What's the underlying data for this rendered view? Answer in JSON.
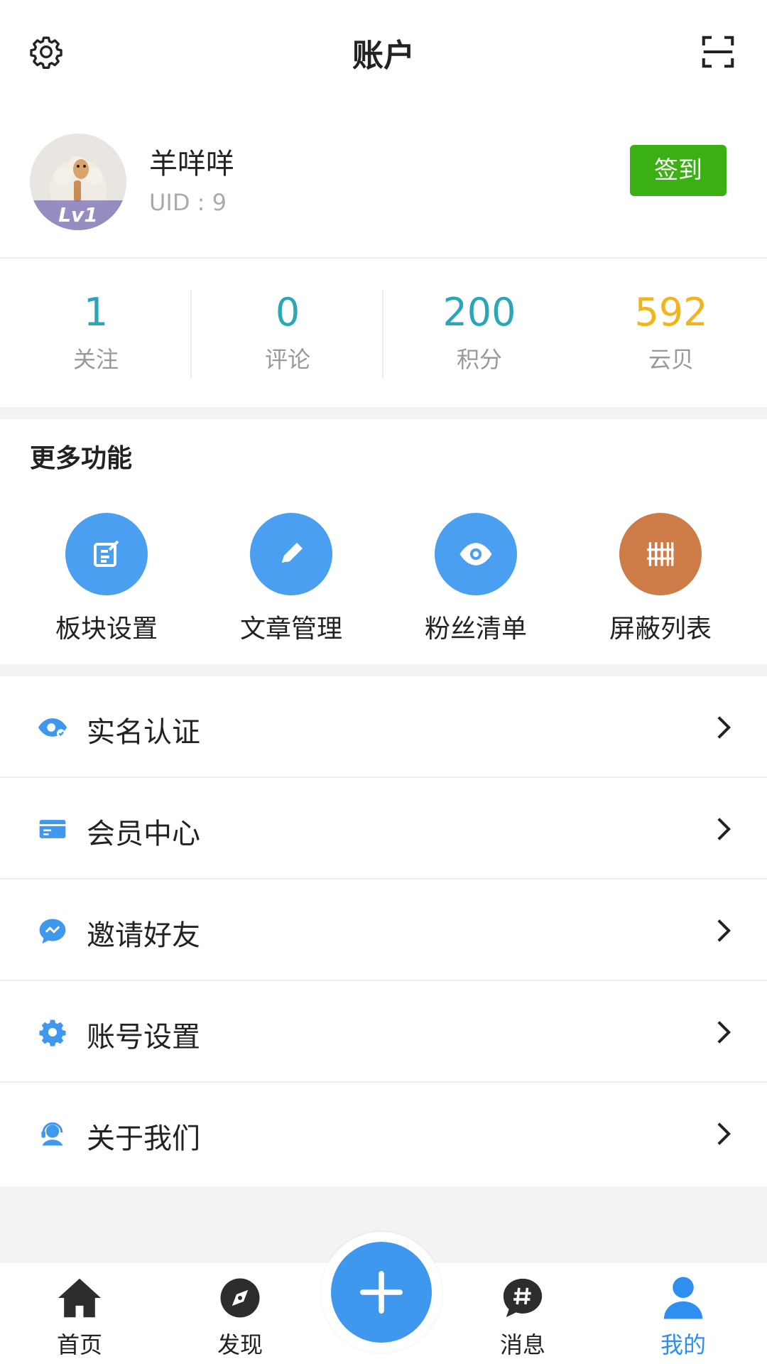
{
  "header": {
    "title": "账户",
    "settings_icon": "gear-icon",
    "scan_icon": "scan-icon"
  },
  "profile": {
    "username": "羊咩咩",
    "uid": "UID : 9",
    "level": "Lv1",
    "signin_label": "签到"
  },
  "stats": [
    {
      "value": "1",
      "label": "关注"
    },
    {
      "value": "0",
      "label": "评论"
    },
    {
      "value": "200",
      "label": "积分"
    },
    {
      "value": "592",
      "label": "云贝"
    }
  ],
  "more": {
    "title": "更多功能",
    "items": [
      {
        "label": "板块设置",
        "icon": "edit-board-icon",
        "color": "#4a9ff0"
      },
      {
        "label": "文章管理",
        "icon": "pen-icon",
        "color": "#4a9ff0"
      },
      {
        "label": "粉丝清单",
        "icon": "eye-icon",
        "color": "#4a9ff0"
      },
      {
        "label": "屏蔽列表",
        "icon": "block-list-icon",
        "color": "#cd7c48"
      }
    ]
  },
  "menu": [
    {
      "label": "实名认证",
      "icon": "verify-eye-icon"
    },
    {
      "label": "会员中心",
      "icon": "card-icon"
    },
    {
      "label": "邀请好友",
      "icon": "chat-icon"
    },
    {
      "label": "账号设置",
      "icon": "gear-icon"
    },
    {
      "label": "关于我们",
      "icon": "support-agent-icon"
    }
  ],
  "tabbar": {
    "tabs": [
      {
        "label": "首页",
        "icon": "home-icon"
      },
      {
        "label": "发现",
        "icon": "compass-icon"
      },
      {
        "label": "消息",
        "icon": "hashtag-chat-icon"
      },
      {
        "label": "我的",
        "icon": "user-icon"
      }
    ],
    "active": "我的",
    "fab_icon": "plus-icon"
  },
  "colors": {
    "accent": "#2e8ff0",
    "signin_green": "#3bb015",
    "stat_teal": "#2aa6b8",
    "stat_gold": "#f3b41b"
  }
}
